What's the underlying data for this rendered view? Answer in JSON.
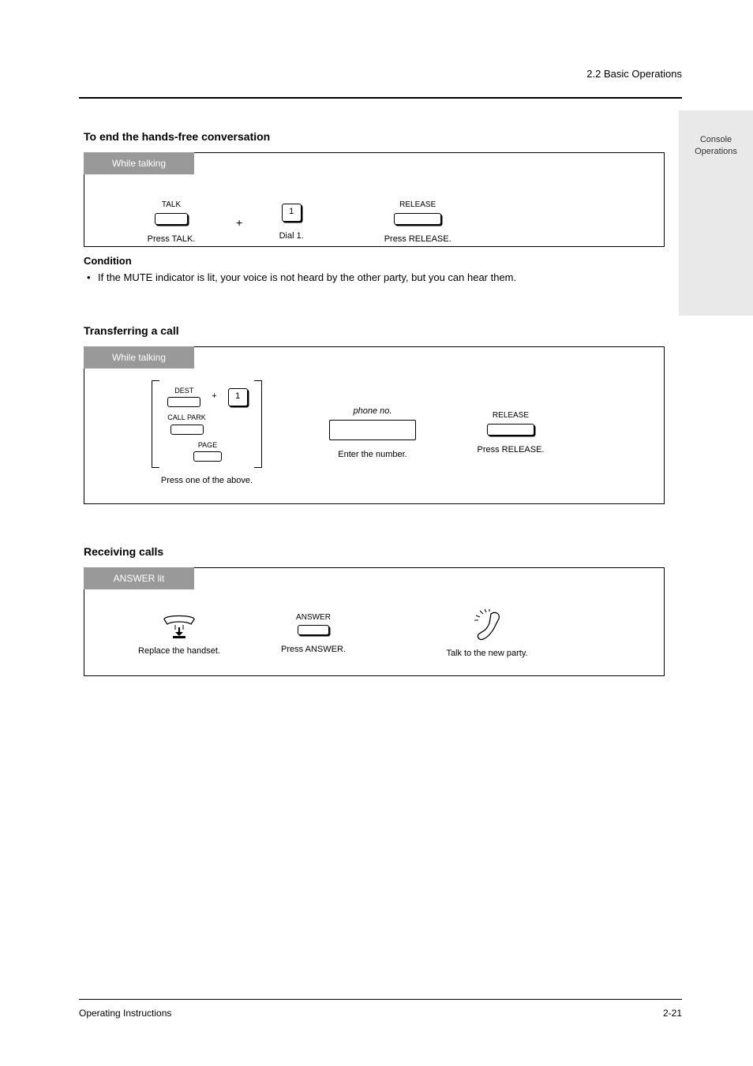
{
  "header": {
    "section_ref": "2.2",
    "section_title": "Basic Operations"
  },
  "side_tab": {
    "line1": "Console",
    "line2": "Operations"
  },
  "block1": {
    "title": "To end the hands-free conversation",
    "tab": "While talking",
    "btn1_top": "TALK",
    "btn1_bot": "Press TALK.",
    "plus": "+",
    "btn2_top": "1",
    "btn2_bot": "Dial 1.",
    "btn3_top": "RELEASE",
    "btn3_bot": "Press RELEASE."
  },
  "block2": {
    "title": "Transferring a call",
    "tab": "While talking",
    "opt1_left": "DEST",
    "opt1_plus": "+",
    "opt1_right": "1",
    "opt1_sub": "",
    "opt2": "CALL PARK",
    "opt3": "PAGE",
    "group_below": "Press one of the above.",
    "bridge_label": "phone no.",
    "bridge_below": "Enter the number.",
    "release": "RELEASE",
    "release_below": "Press RELEASE."
  },
  "block3": {
    "title": "Receiving calls",
    "tab": "ANSWER lit",
    "step1": "Replace the handset.",
    "btn": "ANSWER",
    "btn_below": "Press ANSWER.",
    "step3": "Talk to the new party."
  },
  "condition_head": "Condition",
  "condition_body": "If the MUTE indicator is lit, your voice is not heard by the other party, but you can hear them.",
  "footer": {
    "left": "Operating Instructions",
    "right": "2-21"
  }
}
